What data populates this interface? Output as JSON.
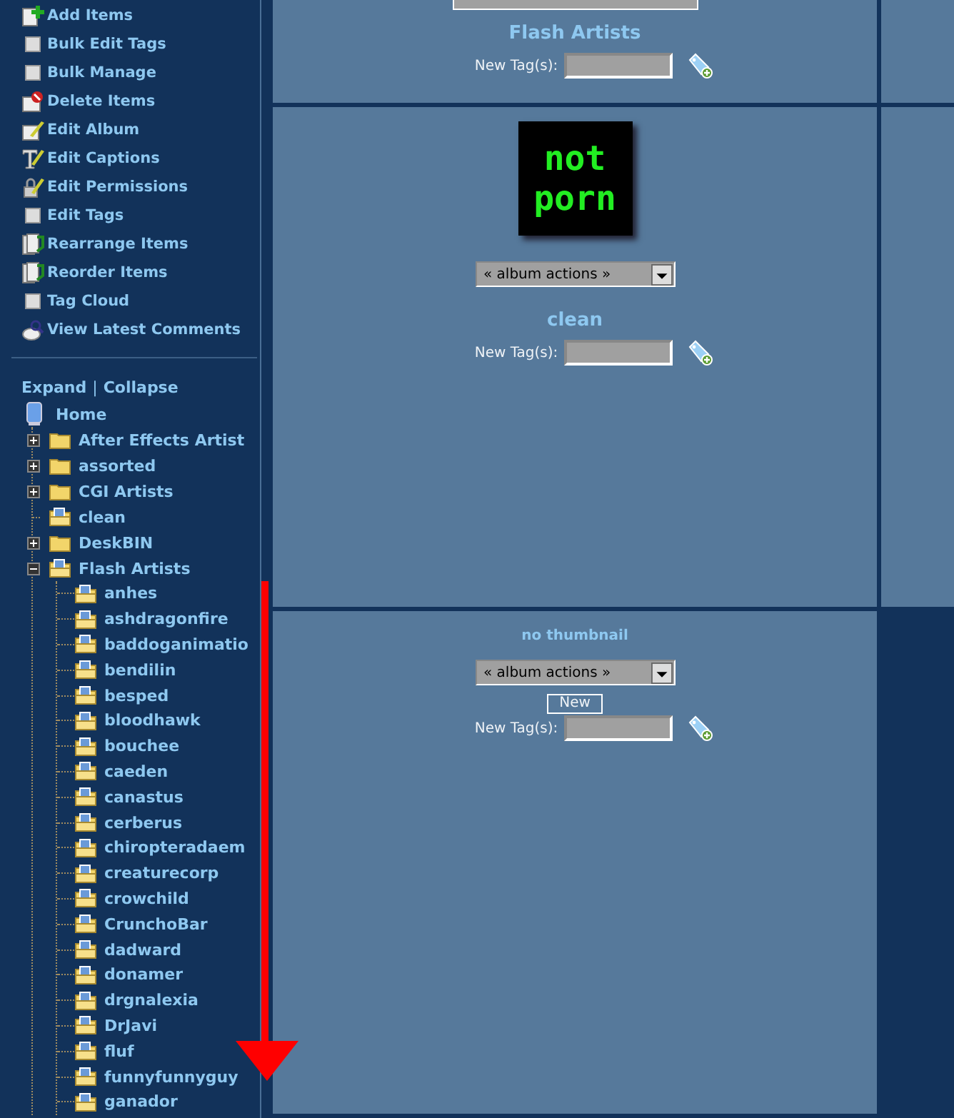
{
  "sidebar": {
    "actions": [
      {
        "label": "Add Items",
        "kind": "add"
      },
      {
        "label": "Bulk Edit Tags",
        "kind": "square"
      },
      {
        "label": "Bulk Manage",
        "kind": "square"
      },
      {
        "label": "Delete Items",
        "kind": "delete"
      },
      {
        "label": "Edit Album",
        "kind": "edit"
      },
      {
        "label": "Edit Captions",
        "kind": "caption"
      },
      {
        "label": "Edit Permissions",
        "kind": "permission"
      },
      {
        "label": "Edit Tags",
        "kind": "square"
      },
      {
        "label": "Rearrange Items",
        "kind": "rearrange"
      },
      {
        "label": "Reorder Items",
        "kind": "rearrange"
      },
      {
        "label": "Tag Cloud",
        "kind": "square"
      },
      {
        "label": "View Latest Comments",
        "kind": "comment"
      }
    ],
    "expand": "Expand",
    "separator": "|",
    "collapse": "Collapse",
    "tree": {
      "label": "Home",
      "children": [
        {
          "label": "After Effects Artist",
          "kind": "collapsed",
          "thumbnail": false
        },
        {
          "label": "assorted",
          "kind": "collapsed",
          "thumbnail": false
        },
        {
          "label": "CGI Artists",
          "kind": "collapsed",
          "thumbnail": false
        },
        {
          "label": "clean",
          "kind": "leaf",
          "thumbnail": true
        },
        {
          "label": "DeskBIN",
          "kind": "collapsed",
          "thumbnail": false
        },
        {
          "label": "Flash Artists",
          "kind": "expanded",
          "thumbnail": true,
          "children": [
            {
              "label": "anhes"
            },
            {
              "label": "ashdragonfire"
            },
            {
              "label": "baddoganimatio"
            },
            {
              "label": "bendilin"
            },
            {
              "label": "besped"
            },
            {
              "label": "bloodhawk"
            },
            {
              "label": "bouchee"
            },
            {
              "label": "caeden"
            },
            {
              "label": "canastus"
            },
            {
              "label": "cerberus"
            },
            {
              "label": "chiropteradaem"
            },
            {
              "label": "creaturecorp"
            },
            {
              "label": "crowchild"
            },
            {
              "label": "CrunchoBar"
            },
            {
              "label": "dadward"
            },
            {
              "label": "donamer"
            },
            {
              "label": "drgnalexia"
            },
            {
              "label": "DrJavi"
            },
            {
              "label": "fluf"
            },
            {
              "label": "funnyfunnyguy"
            },
            {
              "label": "ganador"
            }
          ]
        }
      ]
    }
  },
  "albums": [
    {
      "kind": "cut",
      "title": "Flash Artists",
      "tag_label": "New Tag(s):"
    },
    {
      "kind": "thumb",
      "thumbnail": [
        "not",
        "porn"
      ],
      "select": "« album actions »",
      "title": "clean",
      "tag_label": "New Tag(s):"
    },
    {
      "kind": "none",
      "thumbnail_text": "no thumbnail",
      "select": "« album actions »",
      "button": "New",
      "tag_label": "New Tag(s):"
    }
  ]
}
